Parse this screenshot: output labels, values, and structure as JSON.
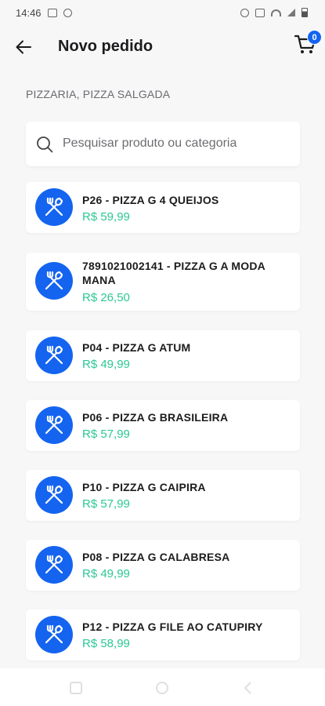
{
  "status_bar": {
    "time": "14:46"
  },
  "header": {
    "title": "Novo pedido",
    "cart_count": "0"
  },
  "category": {
    "title": "PIZZARIA, PIZZA SALGADA"
  },
  "search": {
    "placeholder": "Pesquisar produto ou categoria",
    "value": ""
  },
  "products": [
    {
      "name": "P26 - PIZZA G 4 QUEIJOS",
      "price": "R$ 59,99"
    },
    {
      "name": "7891021002141 - PIZZA G A MODA MANA",
      "price": "R$ 26,50"
    },
    {
      "name": "P04 - PIZZA G ATUM",
      "price": "R$ 49,99"
    },
    {
      "name": "P06 - PIZZA G BRASILEIRA",
      "price": "R$ 57,99"
    },
    {
      "name": "P10 - PIZZA G CAIPIRA",
      "price": "R$ 57,99"
    },
    {
      "name": "P08 - PIZZA G CALABRESA",
      "price": "R$ 49,99"
    },
    {
      "name": "P12 - PIZZA G FILE AO CATUPIRY",
      "price": "R$ 58,99"
    }
  ],
  "colors": {
    "accent": "#1464f0",
    "price": "#2cc795",
    "background": "#f7f7f8"
  },
  "icons": {
    "back": "arrow-left-icon",
    "cart": "shopping-cart-icon",
    "search": "search-icon",
    "product": "fork-knife-icon"
  }
}
